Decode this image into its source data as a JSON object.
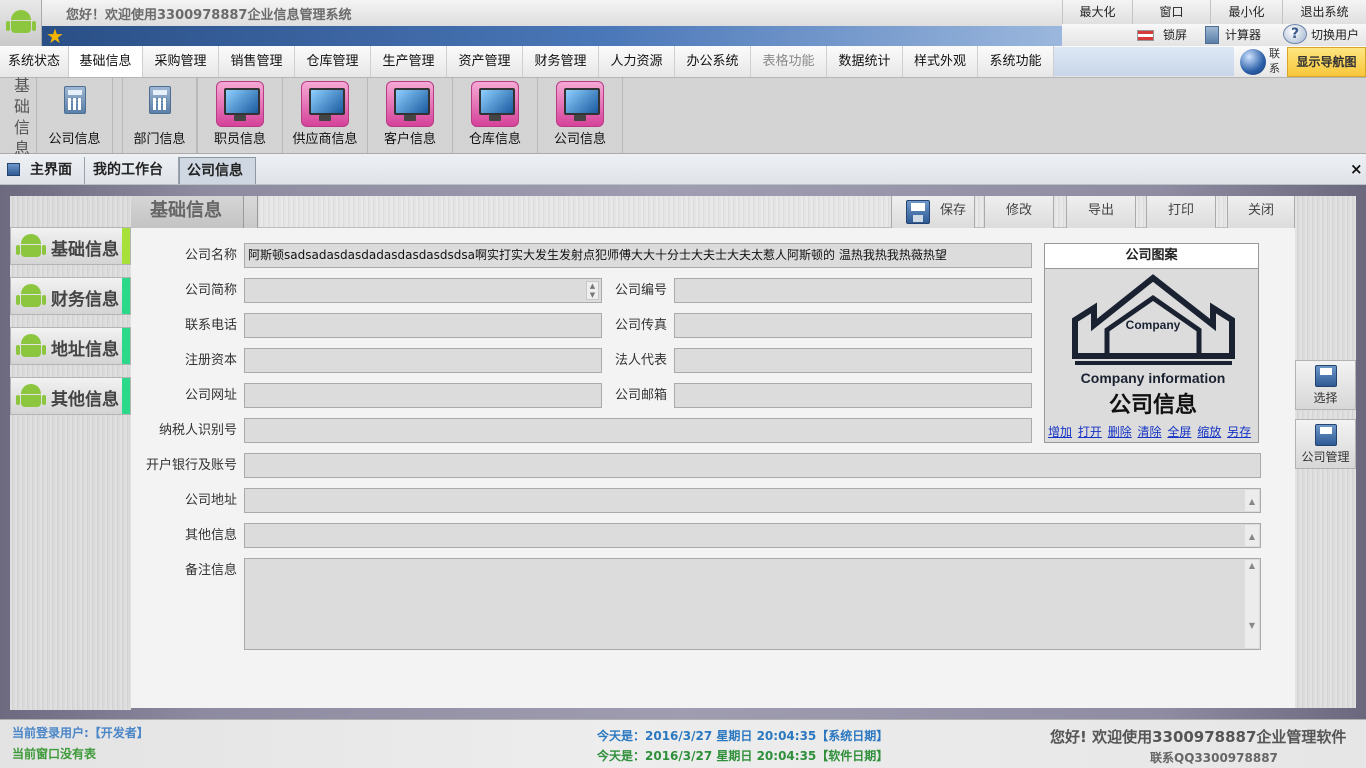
{
  "window": {
    "title": "您好！欢迎使用3300978887企业信息管理系统",
    "buttons": [
      "最大化",
      "窗口",
      "最小化",
      "退出系统"
    ],
    "tools": {
      "lock": "锁屏",
      "calculator": "计算器",
      "switch_user": "切换用户"
    }
  },
  "menu": {
    "items": [
      "系统状态",
      "基础信息",
      "采购管理",
      "销售管理",
      "仓库管理",
      "生产管理",
      "资产管理",
      "财务管理",
      "人力资源",
      "办公系统",
      "表格功能",
      "数据统计",
      "样式外观",
      "系统功能"
    ],
    "contact": "联系",
    "nav_button": "显示导航图"
  },
  "ribbon": {
    "group_label": [
      "基",
      "础",
      "信",
      "息"
    ],
    "buttons": [
      {
        "label": "公司信息",
        "icon": "calculator-icon"
      },
      {
        "label": "部门信息",
        "icon": "calculator-icon"
      },
      {
        "label": "职员信息",
        "icon": "monitor-icon"
      },
      {
        "label": "供应商信息",
        "icon": "monitor-icon"
      },
      {
        "label": "客户信息",
        "icon": "monitor-icon"
      },
      {
        "label": "仓库信息",
        "icon": "monitor-icon"
      },
      {
        "label": "公司信息",
        "icon": "monitor-icon"
      }
    ]
  },
  "tabs": [
    "主界面",
    "我的工作台",
    "公司信息"
  ],
  "tab_close": "×",
  "sidebar": {
    "items": [
      {
        "label": "基础信息",
        "accent": "#a8e03a"
      },
      {
        "label": "财务信息",
        "accent": "#2bd98a"
      },
      {
        "label": "地址信息",
        "accent": "#2bd98a"
      },
      {
        "label": "其他信息",
        "accent": "#2bd98a"
      }
    ]
  },
  "form": {
    "section_title": "基础信息",
    "toolbar": {
      "save": "保存",
      "edit": "修改",
      "export": "导出",
      "print": "打印",
      "close": "关闭"
    },
    "labels": {
      "company_name": "公司名称",
      "short_name": "公司简称",
      "company_no": "公司编号",
      "phone": "联系电话",
      "fax": "公司传真",
      "capital": "注册资本",
      "legal_rep": "法人代表",
      "website": "公司网址",
      "email": "公司邮箱",
      "tax_id": "纳税人识别号",
      "bank": "开户银行及账号",
      "address": "公司地址",
      "other": "其他信息",
      "remarks": "备注信息"
    },
    "values": {
      "company_name": "阿斯顿sadsadasdasdadasdasdasdsdsa啊实打实大发生发射点犯师傅大大十分士大夫士大夫太惹人阿斯顿的            温热我热我热薇热望",
      "short_name": "",
      "company_no": "",
      "phone": "",
      "fax": "",
      "capital": "",
      "legal_rep": "",
      "website": "",
      "email": "",
      "tax_id": "",
      "bank": "",
      "address": "",
      "other": "",
      "remarks": ""
    }
  },
  "logo_panel": {
    "title": "公司图案",
    "logo_word": "Company",
    "logo_line": "Company information",
    "logo_cn": "公司信息",
    "links": [
      "增加",
      "打开",
      "删除",
      "清除",
      "全屏",
      "缩放",
      "另存"
    ]
  },
  "right_panel": {
    "select": "选择",
    "manage": "公司管理"
  },
  "status": {
    "user": "当前登录用户:【开发者】",
    "window": "当前窗口没有表",
    "sys_date": "今天是：2016/3/27 星期日 20:04:35【系统日期】",
    "soft_date": "今天是：2016/3/27 星期日 20:04:35【软件日期】",
    "welcome": "您好! 欢迎使用3300978887企业管理软件",
    "contact": "联系QQ3300978887"
  }
}
